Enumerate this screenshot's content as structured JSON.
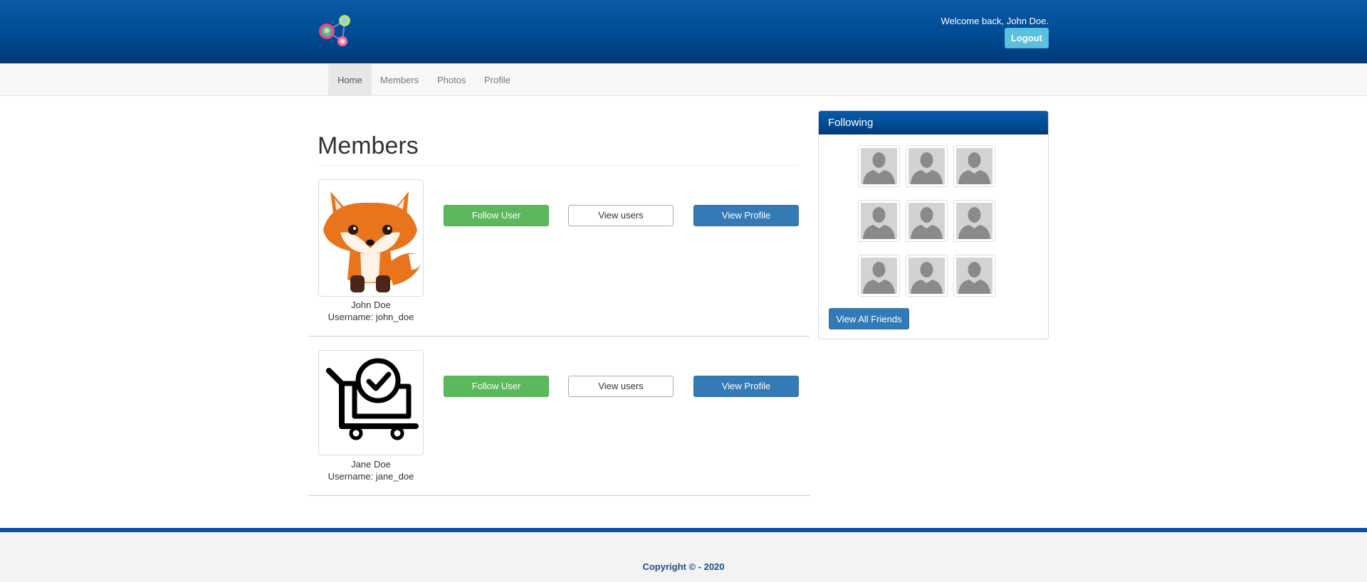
{
  "header": {
    "welcome_text": "Welcome back, John Doe.",
    "logout_label": "Logout"
  },
  "nav": {
    "items": [
      {
        "label": "Home",
        "active": true
      },
      {
        "label": "Members",
        "active": false
      },
      {
        "label": "Photos",
        "active": false
      },
      {
        "label": "Profile",
        "active": false
      }
    ]
  },
  "main": {
    "title": "Members",
    "members": [
      {
        "name": "John Doe",
        "username": "Username: john_doe",
        "follow_label": "Follow User",
        "view_users_label": "View users",
        "view_profile_label": "View Profile",
        "avatar_icon": "fox-icon"
      },
      {
        "name": "Jane Doe",
        "username": "Username: jane_doe",
        "follow_label": "Follow User",
        "view_users_label": "View users",
        "view_profile_label": "View Profile",
        "avatar_icon": "shopping-cart-check-icon"
      }
    ]
  },
  "sidebar": {
    "panel_title": "Following",
    "friend_avatar_icon": "default-user-icon",
    "view_all_label": "View All Friends"
  },
  "footer": {
    "copyright": "Copyright © - 2020"
  },
  "colors": {
    "brand_blue": "#004b93",
    "follow_green": "#5cb85c",
    "primary_blue": "#337ab7",
    "info_cyan": "#5bc0de"
  }
}
